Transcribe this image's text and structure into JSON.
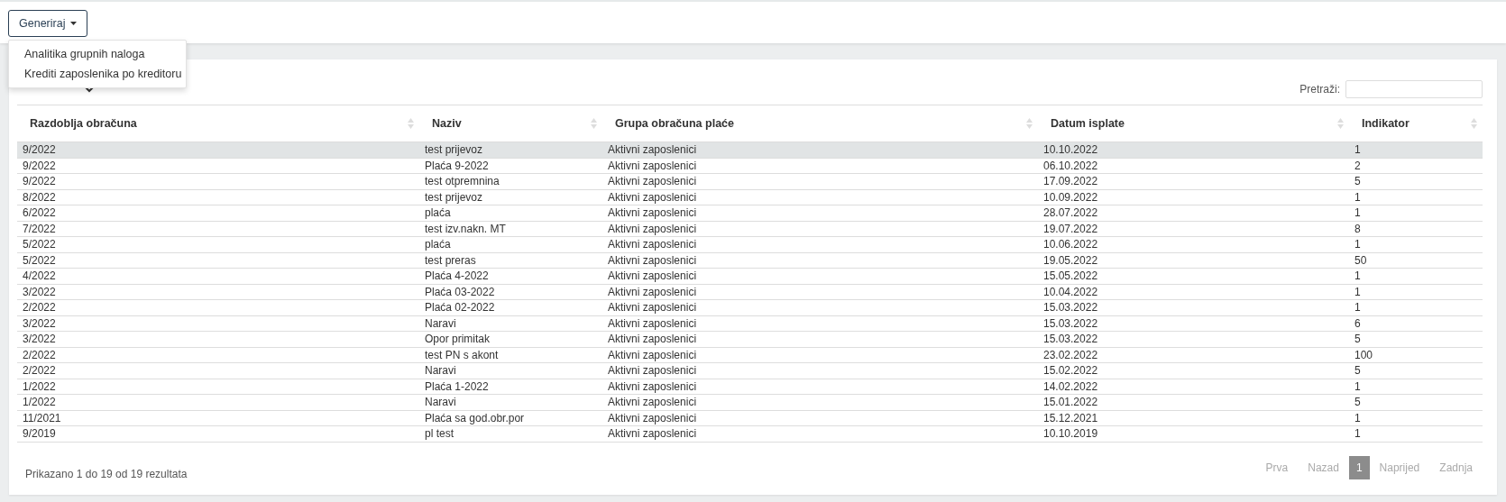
{
  "toolbar": {
    "generate_button": {
      "label": "Generiraj",
      "expanded": true
    },
    "menu_items": [
      "Analitika grupnih naloga",
      "Krediti zaposlenika po kreditoru"
    ]
  },
  "search": {
    "label": "Pretraži:"
  },
  "table": {
    "columns": [
      "Razdoblja obračuna",
      "Naziv",
      "Grupa obračuna plaće",
      "Datum isplate",
      "Indikator"
    ],
    "rows": [
      {
        "cells": [
          "9/2022",
          "test prijevoz",
          "Aktivni zaposlenici",
          "10.10.2022",
          "1"
        ],
        "selected": true
      },
      {
        "cells": [
          "9/2022",
          "Plaća 9-2022",
          "Aktivni zaposlenici",
          "06.10.2022",
          "2"
        ],
        "selected": false
      },
      {
        "cells": [
          "9/2022",
          "test otpremnina",
          "Aktivni zaposlenici",
          "17.09.2022",
          "5"
        ],
        "selected": false
      },
      {
        "cells": [
          "8/2022",
          "test prijevoz",
          "Aktivni zaposlenici",
          "10.09.2022",
          "1"
        ],
        "selected": false
      },
      {
        "cells": [
          "6/2022",
          "plaća",
          "Aktivni zaposlenici",
          "28.07.2022",
          "1"
        ],
        "selected": false
      },
      {
        "cells": [
          "7/2022",
          "test izv.nakn. MT",
          "Aktivni zaposlenici",
          "19.07.2022",
          "8"
        ],
        "selected": false
      },
      {
        "cells": [
          "5/2022",
          "plaća",
          "Aktivni zaposlenici",
          "10.06.2022",
          "1"
        ],
        "selected": false
      },
      {
        "cells": [
          "5/2022",
          "test preras",
          "Aktivni zaposlenici",
          "19.05.2022",
          "50"
        ],
        "selected": false
      },
      {
        "cells": [
          "4/2022",
          "Plaća 4-2022",
          "Aktivni zaposlenici",
          "15.05.2022",
          "1"
        ],
        "selected": false
      },
      {
        "cells": [
          "3/2022",
          "Plaća 03-2022",
          "Aktivni zaposlenici",
          "10.04.2022",
          "1"
        ],
        "selected": false
      },
      {
        "cells": [
          "2/2022",
          "Plaća 02-2022",
          "Aktivni zaposlenici",
          "15.03.2022",
          "1"
        ],
        "selected": false
      },
      {
        "cells": [
          "3/2022",
          "Naravi",
          "Aktivni zaposlenici",
          "15.03.2022",
          "6"
        ],
        "selected": false
      },
      {
        "cells": [
          "3/2022",
          "Opor primitak",
          "Aktivni zaposlenici",
          "15.03.2022",
          "5"
        ],
        "selected": false
      },
      {
        "cells": [
          "2/2022",
          "test PN s akont",
          "Aktivni zaposlenici",
          "23.02.2022",
          "100"
        ],
        "selected": false
      },
      {
        "cells": [
          "2/2022",
          "Naravi",
          "Aktivni zaposlenici",
          "15.02.2022",
          "5"
        ],
        "selected": false
      },
      {
        "cells": [
          "1/2022",
          "Plaća 1-2022",
          "Aktivni zaposlenici",
          "14.02.2022",
          "1"
        ],
        "selected": false
      },
      {
        "cells": [
          "1/2022",
          "Naravi",
          "Aktivni zaposlenici",
          "15.01.2022",
          "5"
        ],
        "selected": false
      },
      {
        "cells": [
          "11/2021",
          "Plaća sa god.obr.por",
          "Aktivni zaposlenici",
          "15.12.2021",
          "1"
        ],
        "selected": false
      },
      {
        "cells": [
          "9/2019",
          "pl test",
          "Aktivni zaposlenici",
          "10.10.2019",
          "1"
        ],
        "selected": false
      }
    ]
  },
  "info": "Prikazano 1 do 19 od 19 rezultata",
  "pagination": [
    {
      "label": "Prva",
      "disabled": true,
      "selected": false
    },
    {
      "label": "Nazad",
      "disabled": true,
      "selected": false
    },
    {
      "label": "1",
      "disabled": false,
      "selected": true
    },
    {
      "label": "Naprijed",
      "disabled": true,
      "selected": false
    },
    {
      "label": "Zadnja",
      "disabled": true,
      "selected": false
    }
  ]
}
